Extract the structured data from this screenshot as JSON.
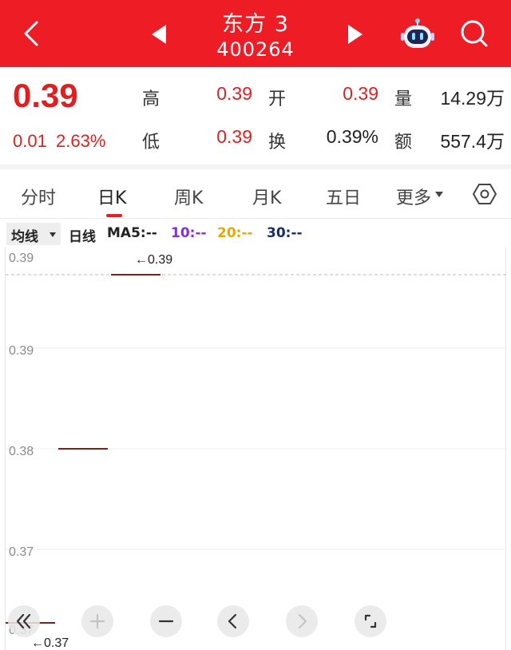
{
  "header": {
    "title": "东方 3",
    "code": "400264",
    "bg_color": "#ee1c25",
    "back_icon": "chevron-left-icon",
    "prev_icon": "triangle-left-icon",
    "next_icon": "triangle-right-icon",
    "robot_icon": "robot-icon",
    "search_icon": "search-icon"
  },
  "quote": {
    "price": "0.39",
    "change": "0.01",
    "change_pct": "2.63%",
    "rows": [
      {
        "label": "高",
        "value": "0.39"
      },
      {
        "label": "开",
        "value": "0.39"
      },
      {
        "label": "量",
        "value": "14.29万"
      },
      {
        "label": "低",
        "value": "0.39"
      },
      {
        "label": "换",
        "value": "0.39%"
      },
      {
        "label": "额",
        "value": "557.4万"
      }
    ],
    "up_color": "#e02020"
  },
  "tabs": {
    "items": [
      "分时",
      "日K",
      "周K",
      "月K",
      "五日",
      "更多"
    ],
    "active": "日K"
  },
  "ma": {
    "select_label": "均线",
    "line_label": "日线",
    "ma5": "MA5:--",
    "ma10": "10:--",
    "ma20": "20:--",
    "ma30": "30:--",
    "colors": {
      "ma5": "#222222",
      "ma10": "#8a2be2",
      "ma20": "#e6a800",
      "ma30": "#1b2a6b"
    }
  },
  "chart_data": {
    "type": "candlestick",
    "y_tick_labels": [
      "0.39",
      "0.39",
      "0.38",
      "0.37",
      "0.37"
    ],
    "candles": [
      {
        "open": 0.37,
        "close": 0.37,
        "high": 0.37,
        "low": 0.37
      },
      {
        "open": 0.38,
        "close": 0.38,
        "high": 0.38,
        "low": 0.38
      },
      {
        "open": 0.39,
        "close": 0.39,
        "high": 0.39,
        "low": 0.39
      }
    ],
    "high_marker": "←0.39",
    "low_marker": "←0.37",
    "grid": true,
    "candle_color": "#8b1a1a"
  },
  "controls": [
    "double-chevron-left-icon",
    "plus-icon",
    "minus-icon",
    "chevron-left-icon",
    "chevron-right-icon",
    "fullscreen-icon"
  ]
}
